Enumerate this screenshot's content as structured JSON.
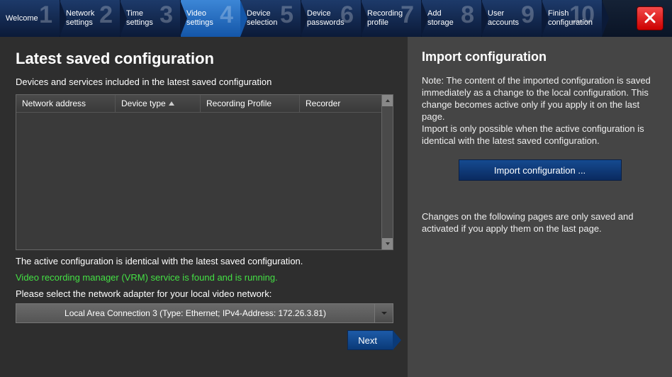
{
  "wizard": {
    "steps": [
      {
        "num": "1",
        "label": "Welcome"
      },
      {
        "num": "2",
        "label": "Network\nsettings"
      },
      {
        "num": "3",
        "label": "Time\nsettings"
      },
      {
        "num": "4",
        "label": "Video\nsettings"
      },
      {
        "num": "5",
        "label": "Device\nselection"
      },
      {
        "num": "6",
        "label": "Device\npasswords"
      },
      {
        "num": "7",
        "label": "Recording\nprofile"
      },
      {
        "num": "8",
        "label": "Add\nstorage"
      },
      {
        "num": "9",
        "label": "User\naccounts"
      },
      {
        "num": "10",
        "label": "Finish\nconfiguration"
      }
    ],
    "active_index": 3
  },
  "left": {
    "title": "Latest saved configuration",
    "subtitle": "Devices and services included in the latest saved configuration",
    "columns": [
      "Network address",
      "Device type",
      "Recording Profile",
      "Recorder"
    ],
    "sort_column_index": 1,
    "rows": [],
    "status_identical": "The active configuration is identical with the latest saved configuration.",
    "status_vrm": "Video recording manager (VRM) service is found and is running.",
    "adapter_prompt": "Please select the network adapter for your local video network:",
    "adapter_selected": "Local Area Connection 3 (Type: Ethernet; IPv4-Address: 172.26.3.81)",
    "next_label": "Next"
  },
  "right": {
    "title": "Import configuration",
    "note": "Note: The content of the imported configuration is saved immediately as a change to the local configuration. This change becomes active only if you apply it on the last page.\nImport is only possible when the active configuration is identical with the latest saved configuration.",
    "import_button": "Import configuration ...",
    "changes_note": "Changes on the following pages are only saved and activated if you apply them on the last page."
  }
}
